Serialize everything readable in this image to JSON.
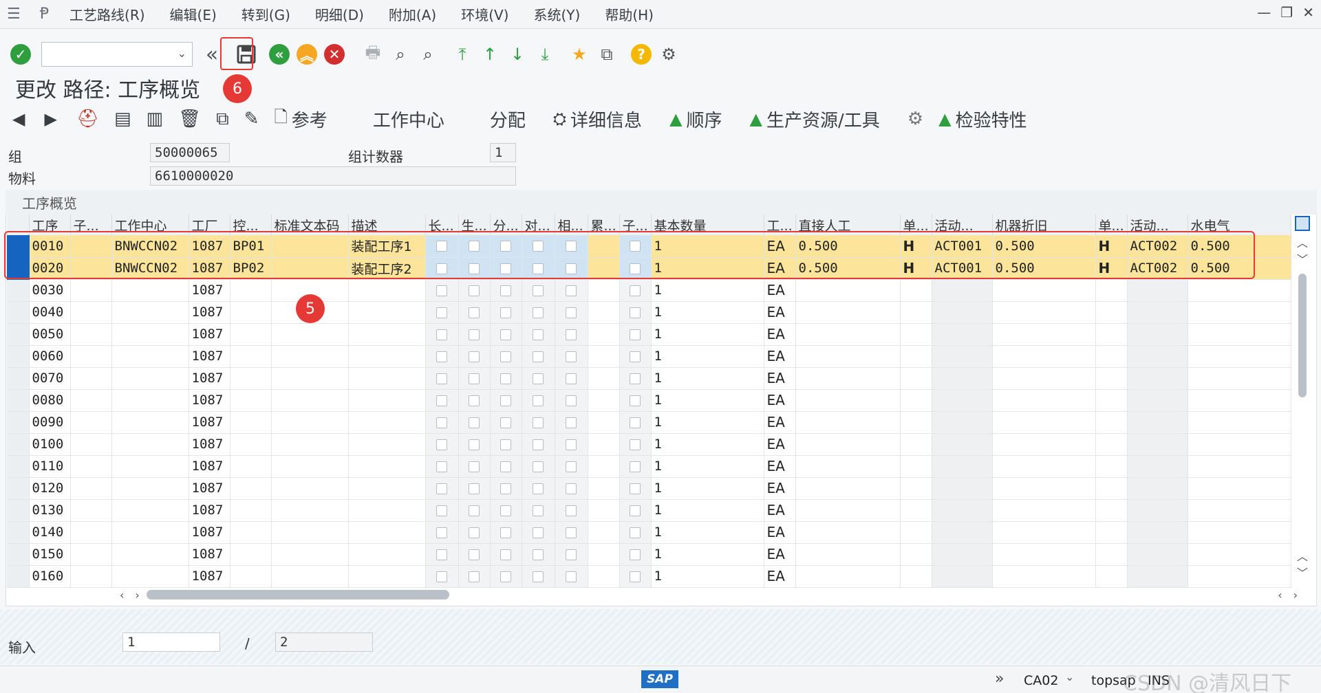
{
  "menu": {
    "items": [
      "工艺路线(R)",
      "编辑(E)",
      "转到(G)",
      "明细(D)",
      "附加(A)",
      "环境(V)",
      "系统(Y)",
      "帮助(H)"
    ]
  },
  "toolbar": {
    "icons": [
      "check-icon",
      "command-field",
      "back-double-icon",
      "save-icon",
      "back-icon",
      "exit-icon",
      "cancel-icon",
      "print-icon",
      "find-icon",
      "find-next-icon",
      "first-page-icon",
      "prev-page-icon",
      "next-page-icon",
      "last-page-icon",
      "bookmark-icon",
      "new-session-icon",
      "help-icon",
      "settings-icon"
    ]
  },
  "screen": {
    "title": "更改 路径: 工序概览"
  },
  "app_toolbar": {
    "reference": "参考",
    "work_center": "工作中心",
    "allocation": "分配",
    "details": "详细信息",
    "sequence": "顺序",
    "prt": "生产资源/工具",
    "inspection": "检验特性"
  },
  "header": {
    "group_label": "组",
    "group_value": "50000065",
    "counter_label": "组计数器",
    "counter_value": "1",
    "material_label": "物料",
    "material_value": "6610000020"
  },
  "grid": {
    "title": "工序概览",
    "columns": [
      "工序",
      "子...",
      "工作中心",
      "工厂",
      "控...",
      "标准文本码",
      "描述",
      "长...",
      "生...",
      "分...",
      "对...",
      "相...",
      "累...",
      "子...",
      "基本数量",
      "工...",
      "直接人工",
      "单...",
      "活动...",
      "机器折旧",
      "单...",
      "活动...",
      "水电气"
    ],
    "rows": [
      {
        "op": "0010",
        "wc": "BNWCCN02",
        "plant": "1087",
        "ctrl": "BP01",
        "desc": "装配工序1",
        "qty": "1",
        "unit": "EA",
        "labor": "0.500",
        "u1": "H",
        "act1": "ACT001",
        "mach": "0.500",
        "u2": "H",
        "act2": "ACT002",
        "util": "0.500"
      },
      {
        "op": "0020",
        "wc": "BNWCCN02",
        "plant": "1087",
        "ctrl": "BP02",
        "desc": "装配工序2",
        "qty": "1",
        "unit": "EA",
        "labor": "0.500",
        "u1": "H",
        "act1": "ACT001",
        "mach": "0.500",
        "u2": "H",
        "act2": "ACT002",
        "util": "0.500"
      },
      {
        "op": "0030",
        "plant": "1087",
        "qty": "1",
        "unit": "EA"
      },
      {
        "op": "0040",
        "plant": "1087",
        "qty": "1",
        "unit": "EA"
      },
      {
        "op": "0050",
        "plant": "1087",
        "qty": "1",
        "unit": "EA"
      },
      {
        "op": "0060",
        "plant": "1087",
        "qty": "1",
        "unit": "EA"
      },
      {
        "op": "0070",
        "plant": "1087",
        "qty": "1",
        "unit": "EA"
      },
      {
        "op": "0080",
        "plant": "1087",
        "qty": "1",
        "unit": "EA"
      },
      {
        "op": "0090",
        "plant": "1087",
        "qty": "1",
        "unit": "EA"
      },
      {
        "op": "0100",
        "plant": "1087",
        "qty": "1",
        "unit": "EA"
      },
      {
        "op": "0110",
        "plant": "1087",
        "qty": "1",
        "unit": "EA"
      },
      {
        "op": "0120",
        "plant": "1087",
        "qty": "1",
        "unit": "EA"
      },
      {
        "op": "0130",
        "plant": "1087",
        "qty": "1",
        "unit": "EA"
      },
      {
        "op": "0140",
        "plant": "1087",
        "qty": "1",
        "unit": "EA"
      },
      {
        "op": "0150",
        "plant": "1087",
        "qty": "1",
        "unit": "EA"
      },
      {
        "op": "0160",
        "plant": "1087",
        "qty": "1",
        "unit": "EA"
      }
    ]
  },
  "footer": {
    "entry_label": "输入",
    "entry_value": "1",
    "separator": "/",
    "total_value": "2"
  },
  "annotations": {
    "badge_5": "5",
    "badge_6": "6"
  },
  "status": {
    "logo": "SAP",
    "transaction": "CA02",
    "server": "topsap",
    "mode": "INS",
    "watermark": "CSDN @清风日下"
  },
  "colors": {
    "highlight_row": "#fce59a",
    "selected_marker": "#1565c0",
    "annotation_red": "#e53935",
    "ok_green": "#2e9e3e",
    "exit_orange": "#f5a623",
    "cancel_red": "#d32f2f"
  }
}
